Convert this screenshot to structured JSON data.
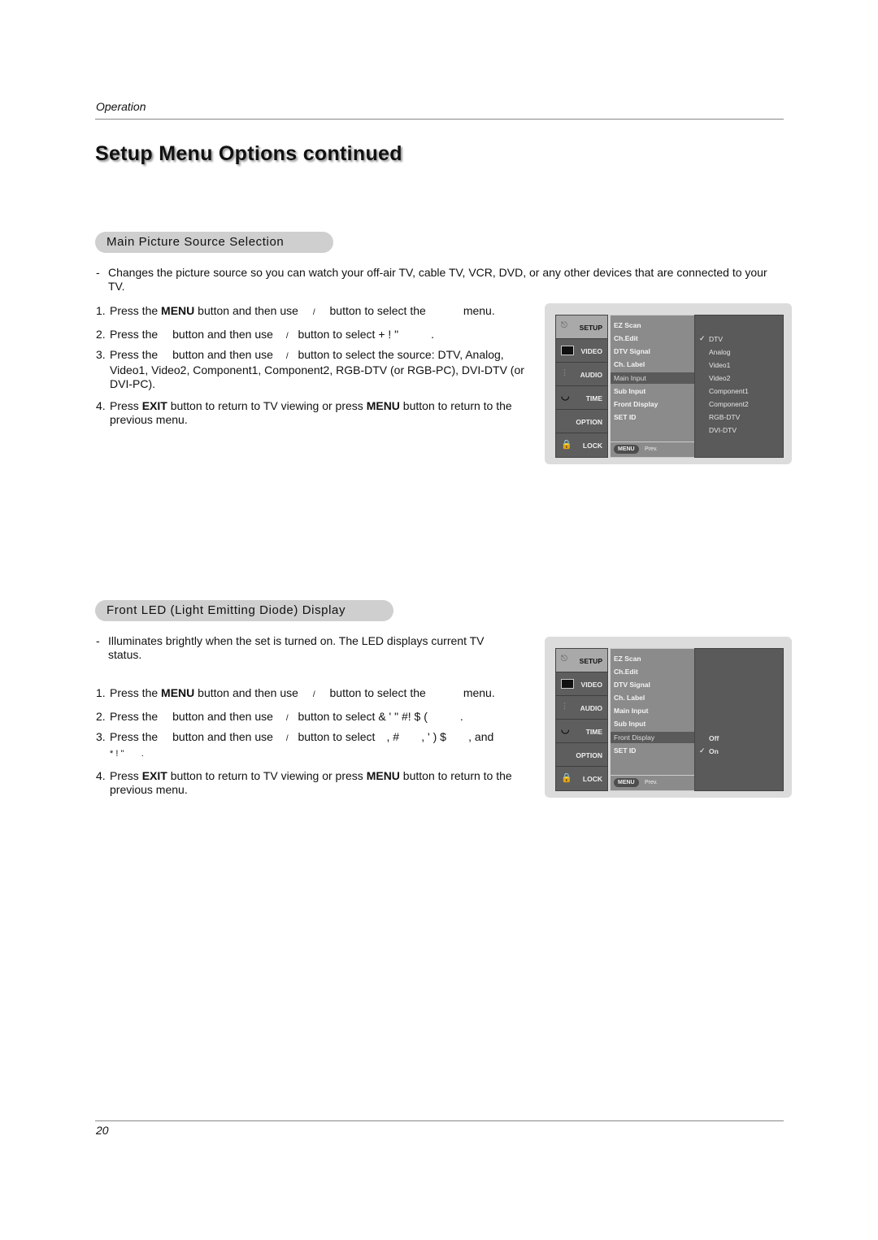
{
  "header": {
    "section": "Operation"
  },
  "page_title": "Setup Menu Options continued",
  "sections": [
    {
      "heading": "Main Picture Source Selection",
      "description": "Changes the picture source so you can watch your off-air TV, cable TV, VCR, DVD, or any other devices that are connected to your TV.",
      "steps": [
        {
          "num": "1.",
          "a": "Press the ",
          "b": "MENU",
          "c": " button and then use",
          "d": "/",
          "e": "button to select the",
          "f": "menu."
        },
        {
          "num": "2.",
          "a": "Press the",
          "c": "button and then use",
          "d": "/",
          "e": "button to select + !   \"",
          "f": "."
        },
        {
          "num": "3.",
          "a": "Press the",
          "c": "button and then use",
          "d": "/",
          "e": "button to select the source: DTV, Analog, Video1, Video2, Component1, Component2, RGB-DTV (or RGB-PC), DVI-DTV (or DVI-PC)."
        },
        {
          "num": "4.",
          "a": "Press ",
          "b": "EXIT",
          "c": " button to return to TV viewing or press ",
          "d": "MENU",
          "e": " button to return to the previous menu."
        }
      ],
      "osd": {
        "tabs": [
          "SETUP",
          "VIDEO",
          "AUDIO",
          "TIME",
          "OPTION",
          "LOCK"
        ],
        "menu_items": [
          "EZ Scan",
          "Ch.Edit",
          "DTV Signal",
          "Ch. Label",
          "Main Input",
          "Sub Input",
          "Front Display",
          "SET ID"
        ],
        "selected_item": "Main Input",
        "options": [
          "DTV",
          "Analog",
          "Video1",
          "Video2",
          "Component1",
          "Component2",
          "RGB-DTV",
          "DVI-DTV"
        ],
        "checked_option": "DTV",
        "menu_button": "MENU",
        "prev_label": "Prev."
      }
    },
    {
      "heading": "Front LED (Light Emitting Diode) Display",
      "description": "Illuminates brightly when the set is turned on. The LED displays current TV status.",
      "steps": [
        {
          "num": "1.",
          "a": "Press the ",
          "b": "MENU",
          "c": " button and then use",
          "d": "/",
          "e": "button to select the",
          "f": "menu."
        },
        {
          "num": "2.",
          "a": "Press the",
          "c": "button and then use",
          "d": "/",
          "e": "button to select & ' \" #! $ (",
          "f": "."
        },
        {
          "num": "3.",
          "a": "Press the",
          "c": "button and then use",
          "d": "/",
          "e": "button to select",
          "f": ", #       , ' ) $       , and",
          "g": "* ! \"       ."
        },
        {
          "num": "4.",
          "a": "Press ",
          "b": "EXIT",
          "c": " button to return to TV viewing or press ",
          "d": "MENU",
          "e": " button to return to the previous menu."
        }
      ],
      "osd": {
        "tabs": [
          "SETUP",
          "VIDEO",
          "AUDIO",
          "TIME",
          "OPTION",
          "LOCK"
        ],
        "menu_items": [
          "EZ Scan",
          "Ch.Edit",
          "DTV Signal",
          "Ch. Label",
          "Main Input",
          "Sub Input",
          "Front Display",
          "SET ID"
        ],
        "selected_item": "Front Display",
        "options": [
          "Off",
          "On"
        ],
        "checked_option": "On",
        "menu_button": "MENU",
        "prev_label": "Prev."
      }
    }
  ],
  "footer": {
    "page_number": "20"
  }
}
